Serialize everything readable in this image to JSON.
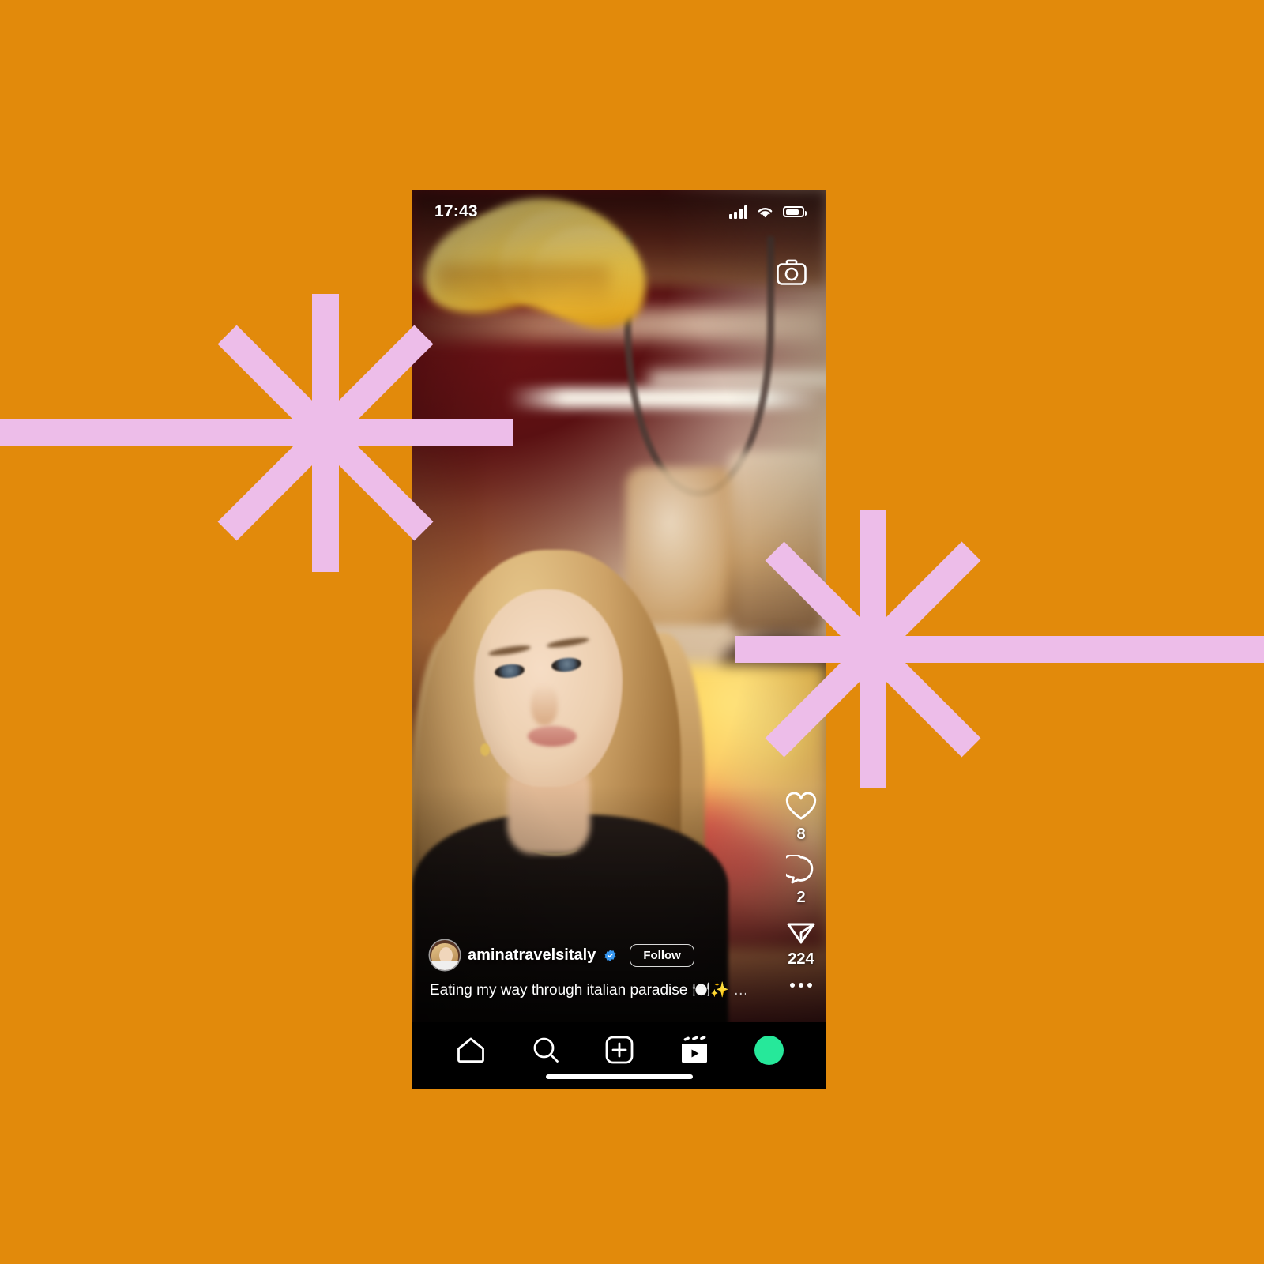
{
  "canvas": {
    "background_color": "#E28A0B",
    "accent_color": "#EDBDE9"
  },
  "phone": {
    "status_bar": {
      "time": "17:43",
      "signal_icon": "cellular-bars-icon",
      "wifi_icon": "wifi-icon",
      "battery_icon": "battery-icon"
    },
    "camera_button": {
      "icon": "camera-icon",
      "label": "Camera"
    },
    "post": {
      "username": "aminatravelsitaly",
      "verified": true,
      "verified_icon": "verified-badge-icon",
      "follow_label": "Follow",
      "avatar_icon": "profile-avatar",
      "caption": "Eating my way through italian paradise 🍽️✨",
      "caption_more": "…"
    },
    "actions": [
      {
        "name": "like",
        "icon": "heart-icon",
        "count": "8"
      },
      {
        "name": "comment",
        "icon": "comment-icon",
        "count": "2"
      },
      {
        "name": "share",
        "icon": "share-icon",
        "count": "224"
      }
    ],
    "more_options_icon": "more-options-icon",
    "nav": [
      {
        "name": "home",
        "icon": "home-icon",
        "label": "Home"
      },
      {
        "name": "search",
        "icon": "search-icon",
        "label": "Search"
      },
      {
        "name": "create",
        "icon": "plus-box-icon",
        "label": "Create"
      },
      {
        "name": "reels",
        "icon": "reels-icon",
        "label": "Reels"
      },
      {
        "name": "profile",
        "icon": "profile-dot",
        "label": "Profile",
        "color": "#26E89A"
      }
    ],
    "home_indicator": "home-indicator-bar"
  },
  "decoration": {
    "starburst_left": "starburst-icon",
    "starburst_right": "starburst-icon",
    "rail_left": "horizontal-rail",
    "rail_right": "horizontal-rail"
  }
}
